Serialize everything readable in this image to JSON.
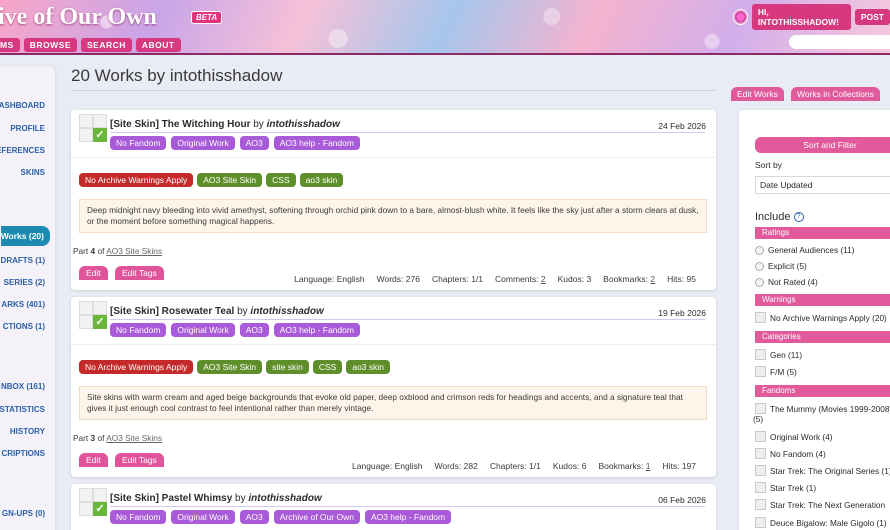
{
  "header": {
    "logo": "ive of Our Own",
    "beta": "BETA",
    "nav": [
      "MS",
      "BROWSE",
      "SEARCH",
      "ABOUT"
    ],
    "greeting": "HI, INTOTHISSHADOW!",
    "post": "POST"
  },
  "sidebar": {
    "items": [
      "ASHBOARD",
      "PROFILE",
      "EFERENCES",
      "SKINS",
      "DRAFTS (1)",
      "SERIES (2)",
      "ARKS (401)",
      "CTIONS (1)",
      "NBOX (161)",
      "STATISTICS",
      "HISTORY",
      "CRIPTIONS",
      "GN-UPS (0)"
    ],
    "active": "Works (20)"
  },
  "main": {
    "title": "20 Works by intothisshadow",
    "works": [
      {
        "title": "[Site Skin] The Witching Hour",
        "by": "by",
        "author": "intothisshadow",
        "date": "24 Feb 2026",
        "fandoms": [
          "No Fandom",
          "Original Work",
          "AO3",
          "AO3 help - Fandom"
        ],
        "warning": "No Archive Warnings Apply",
        "tags": [
          "AO3 Site Skin",
          "CSS",
          "ao3 skin"
        ],
        "summary": "Deep midnight navy bleeding into vivid amethyst, softening through orchid pink down to a bare, almost-blush white. It feels like the sky just after a storm clears at dusk, or the moment before something magical happens.",
        "part": "4",
        "series_prefix": "Part",
        "series_of": "of",
        "series": "AO3 Site Skins",
        "edit": "Edit",
        "edit_tags": "Edit Tags",
        "stats": [
          [
            "Language:",
            "English"
          ],
          [
            "Words:",
            "276"
          ],
          [
            "Chapters:",
            "1/1"
          ],
          [
            "Comments:",
            "2"
          ],
          [
            "Kudos:",
            "3"
          ],
          [
            "Bookmarks:",
            "2"
          ],
          [
            "Hits:",
            "95"
          ]
        ]
      },
      {
        "title": "[Site Skin] Rosewater Teal",
        "by": "by",
        "author": "intothisshadow",
        "date": "19 Feb 2026",
        "fandoms": [
          "No Fandom",
          "Original Work",
          "AO3",
          "AO3 help - Fandom"
        ],
        "warning": "No Archive Warnings Apply",
        "tags": [
          "AO3 Site Skin",
          "site skin",
          "CSS",
          "ao3 skin"
        ],
        "summary": "Site skins with warm cream and aged beige backgrounds that evoke old paper, deep oxblood and crimson reds for headings and accents, and a signature teal that gives it just enough cool contrast to feel intentional rather than merely vintage.",
        "part": "3",
        "series_prefix": "Part",
        "series_of": "of",
        "series": "AO3 Site Skins",
        "edit": "Edit",
        "edit_tags": "Edit Tags",
        "stats": [
          [
            "Language:",
            "English"
          ],
          [
            "Words:",
            "282"
          ],
          [
            "Chapters:",
            "1/1"
          ],
          [
            "Kudos:",
            "6"
          ],
          [
            "Bookmarks:",
            "1"
          ],
          [
            "Hits:",
            "197"
          ]
        ]
      },
      {
        "title": "[Site Skin] Pastel Whimsy",
        "by": "by",
        "author": "intothisshadow",
        "date": "06 Feb 2026",
        "fandoms": [
          "No Fandom",
          "Original Work",
          "AO3",
          "Archive of Our Own",
          "AO3 help - Fandom"
        ]
      }
    ]
  },
  "right": {
    "edit_works": "Edit Works",
    "works_in_collections": "Works in Collections",
    "sort_filter": "Sort and Filter",
    "sort_by": "Sort by",
    "sort_value": "Date Updated",
    "include": "Include",
    "help": "?",
    "ratings_label": "Ratings",
    "ratings": [
      "General Audiences (11)",
      "Explicit (5)",
      "Not Rated (4)"
    ],
    "warnings_label": "Warnings",
    "warnings": [
      "No Archive Warnings Apply (20)"
    ],
    "categories_label": "Categories",
    "categories": [
      "Gen (11)",
      "F/M (5)"
    ],
    "fandoms_label": "Fandoms",
    "fandoms": [
      "The Mummy (Movies 1999-2008)",
      "Original Work (4)",
      "No Fandom (4)",
      "Star Trek: The Original Series (1)",
      "Star Trek (1)",
      "Star Trek: The Next Generation",
      "Deuce Bigalow: Male Gigolo (1)"
    ],
    "fandom_extra": "(5)"
  },
  "colors": {
    "accent": "#d6397f",
    "active": "#1d8bb0",
    "fandom_tag": "#a85ad8",
    "warning_tag": "#c42a2a",
    "tag": "#5f8f2a"
  }
}
